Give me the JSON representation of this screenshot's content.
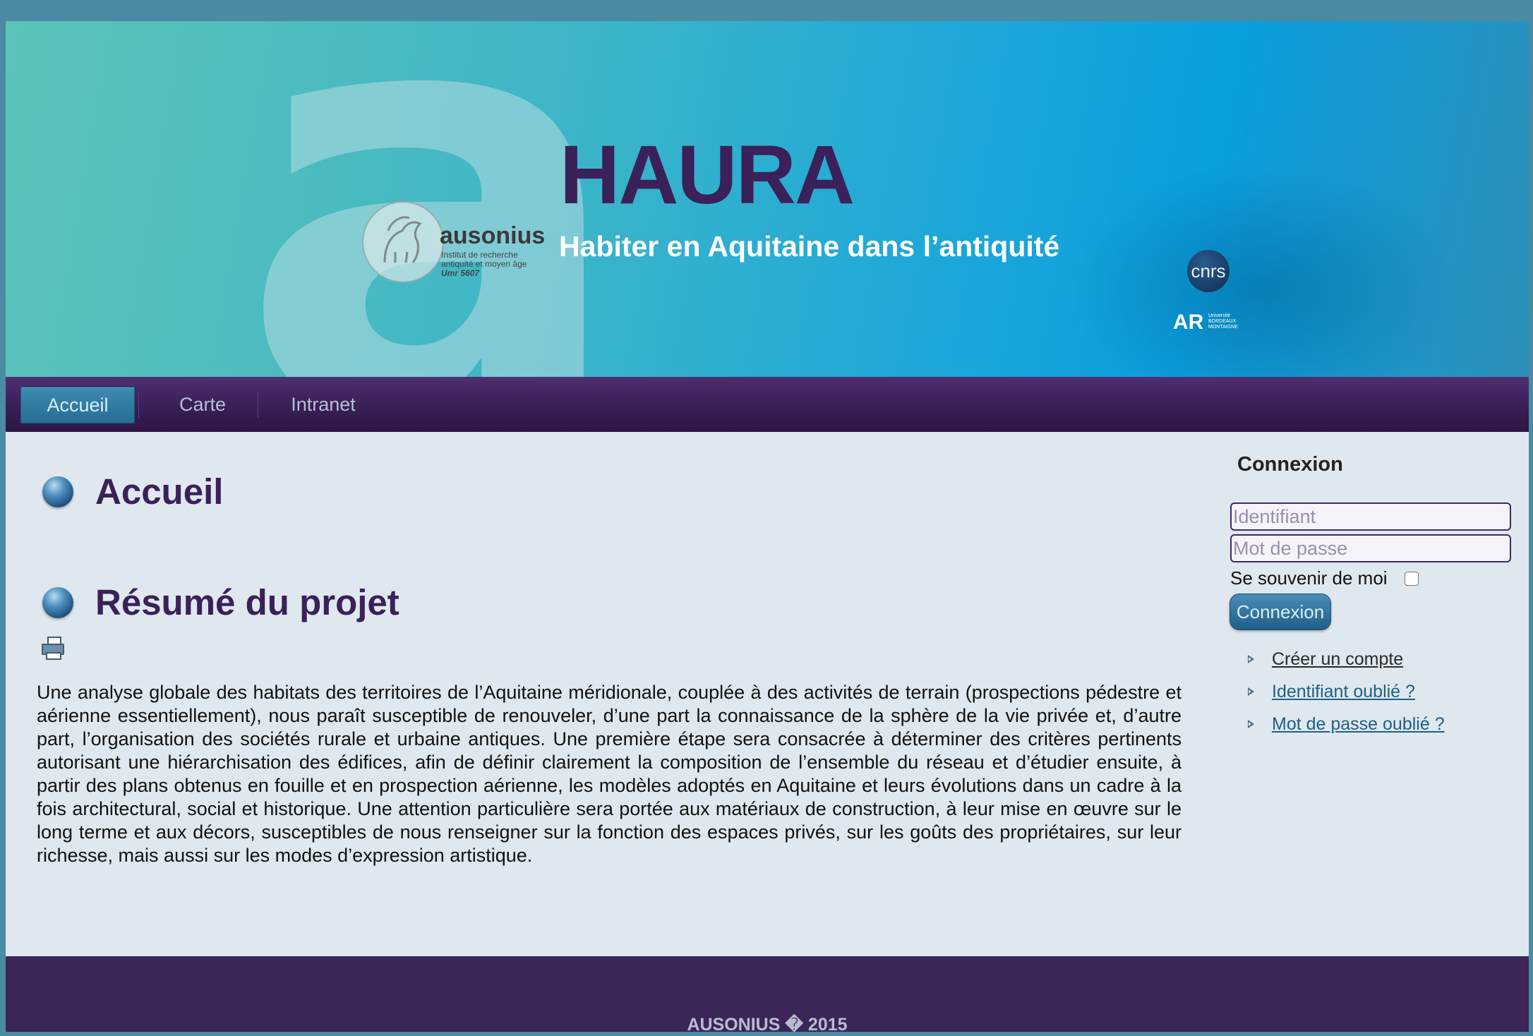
{
  "banner": {
    "logo_letter": "a",
    "title": "HAURA",
    "subtitle": "Habiter en Aquitaine dans l’antiquité",
    "ausonius_logo": {
      "name": "ausonius",
      "line1": "Institut de recherche",
      "line2": "antiquité et moyen âge",
      "line3": "Umr 5607"
    },
    "cnrs_logo": "cnrs",
    "ubm_logo": {
      "mark": "AR",
      "text": "Université BORDEAUX MONTAIGNE"
    }
  },
  "nav": {
    "items": [
      {
        "label": "Accueil",
        "active": true
      },
      {
        "label": "Carte",
        "active": false
      },
      {
        "label": "Intranet",
        "active": false
      }
    ]
  },
  "main": {
    "heading1": "Accueil",
    "heading2": "Résumé du projet",
    "print_icon": "printer-icon",
    "paragraph": "Une analyse globale des habitats des territoires de l’Aquitaine méridionale, couplée à des activités de terrain (prospections pédestre et aérienne essentiellement), nous paraît susceptible de renouveler, d’une part la connaissance de la sphère de la vie privée et, d’autre part, l’organisation des sociétés rurale et urbaine antiques. Une première étape sera consacrée à déterminer des critères pertinents autorisant une hiérarchisation des édifices, afin de définir clairement la composition de l’ensemble du réseau et d’étudier ensuite, à partir des plans obtenus en fouille et en prospection aérienne, les modèles adoptés en Aquitaine et leurs évolutions dans un cadre à la fois architectural, social et historique. Une attention particulière sera portée aux matériaux de construction, à leur mise en œuvre sur le long terme et aux décors, susceptibles de nous renseigner sur la fonction des espaces privés, sur les goûts des propriétaires, sur leur richesse, mais aussi sur les modes d’expression artistique."
  },
  "sidebar": {
    "title": "Connexion",
    "username": {
      "value": "",
      "placeholder": "Identifiant"
    },
    "password": {
      "value": "",
      "placeholder": "Mot de passe"
    },
    "remember_label": "Se souvenir de moi",
    "remember_checked": false,
    "login_button": "Connexion",
    "links": [
      {
        "label": "Créer un compte",
        "color": "#2a2a2a"
      },
      {
        "label": "Identifiant oublié ?",
        "color": "#1f5f88"
      },
      {
        "label": "Mot de passe oublié ?",
        "color": "#1f5f88"
      }
    ]
  },
  "footer": {
    "text": "AUSONIUS � 2015"
  },
  "colors": {
    "page_bg": "#dfe8ee",
    "heading": "#3a2159",
    "nav_bg": "#3a2058",
    "nav_active": "#2f7aa3",
    "footer_bg": "#3b2559"
  }
}
